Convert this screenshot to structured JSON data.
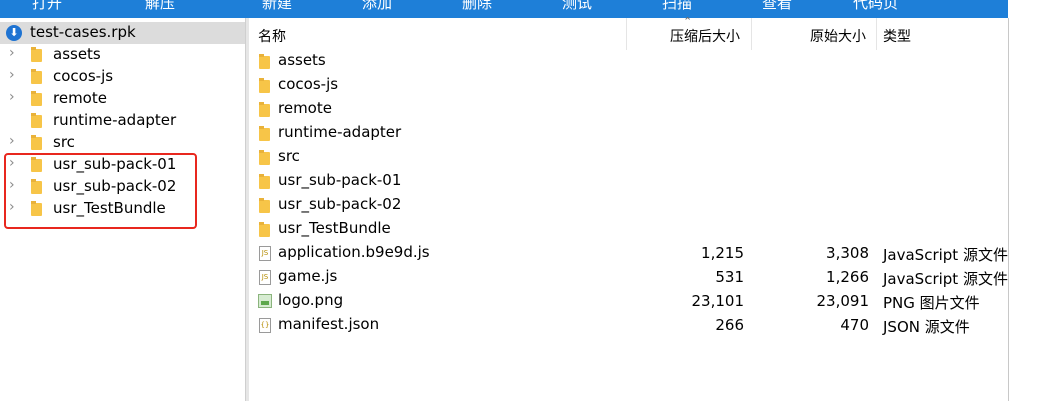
{
  "toolbar": {
    "items": [
      "打开",
      "解压",
      "新建",
      "添加",
      "删除",
      "测试",
      "扫描",
      "查看",
      "代码页"
    ]
  },
  "tree": {
    "root": "test-cases.rpk",
    "items": [
      "assets",
      "cocos-js",
      "remote",
      "runtime-adapter",
      "src",
      "usr_sub-pack-01",
      "usr_sub-pack-02",
      "usr_TestBundle"
    ]
  },
  "list": {
    "columns": {
      "name": "名称",
      "compressed": "压缩后大小",
      "original": "原始大小",
      "type": "类型"
    },
    "folders": [
      "assets",
      "cocos-js",
      "remote",
      "runtime-adapter",
      "src",
      "usr_sub-pack-01",
      "usr_sub-pack-02",
      "usr_TestBundle"
    ],
    "files": [
      {
        "name": "application.b9e9d.js",
        "compressed": "1,215",
        "original": "3,308",
        "type": "JavaScript 源文件",
        "icon": "js-file-icon"
      },
      {
        "name": "game.js",
        "compressed": "531",
        "original": "1,266",
        "type": "JavaScript 源文件",
        "icon": "js-file-icon"
      },
      {
        "name": "logo.png",
        "compressed": "23,101",
        "original": "23,091",
        "type": "PNG 图片文件",
        "icon": "png-file-icon"
      },
      {
        "name": "manifest.json",
        "compressed": "266",
        "original": "470",
        "type": "JSON 源文件",
        "icon": "json-file-icon"
      }
    ]
  },
  "colors": {
    "toolbar": "#1e7fd8",
    "selection": "#dcdcdc",
    "folder": "#f7c548",
    "highlight": "#e8271e"
  }
}
